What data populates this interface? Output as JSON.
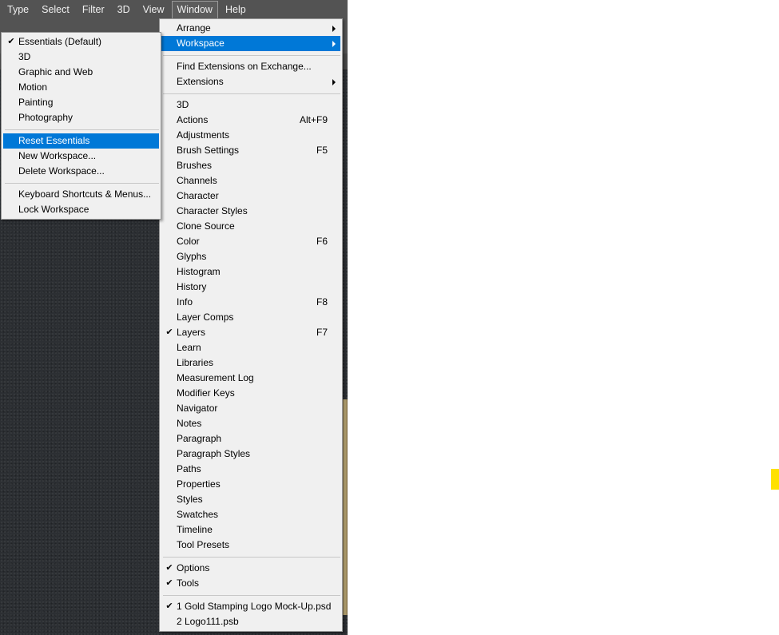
{
  "menubar": {
    "items": [
      {
        "label": "Type"
      },
      {
        "label": "Select"
      },
      {
        "label": "Filter"
      },
      {
        "label": "3D"
      },
      {
        "label": "View"
      },
      {
        "label": "Window",
        "active": true
      },
      {
        "label": "Help"
      }
    ]
  },
  "window_menu": {
    "items": [
      {
        "label": "Arrange",
        "submenu": true
      },
      {
        "label": "Workspace",
        "submenu": true,
        "highlighted": true
      },
      {
        "separator": true
      },
      {
        "label": "Find Extensions on Exchange..."
      },
      {
        "label": "Extensions",
        "submenu": true
      },
      {
        "separator": true
      },
      {
        "label": "3D"
      },
      {
        "label": "Actions",
        "shortcut": "Alt+F9"
      },
      {
        "label": "Adjustments"
      },
      {
        "label": "Brush Settings",
        "shortcut": "F5"
      },
      {
        "label": "Brushes"
      },
      {
        "label": "Channels"
      },
      {
        "label": "Character"
      },
      {
        "label": "Character Styles"
      },
      {
        "label": "Clone Source"
      },
      {
        "label": "Color",
        "shortcut": "F6"
      },
      {
        "label": "Glyphs"
      },
      {
        "label": "Histogram"
      },
      {
        "label": "History"
      },
      {
        "label": "Info",
        "shortcut": "F8"
      },
      {
        "label": "Layer Comps"
      },
      {
        "label": "Layers",
        "shortcut": "F7",
        "checked": true
      },
      {
        "label": "Learn"
      },
      {
        "label": "Libraries"
      },
      {
        "label": "Measurement Log"
      },
      {
        "label": "Modifier Keys"
      },
      {
        "label": "Navigator"
      },
      {
        "label": "Notes"
      },
      {
        "label": "Paragraph"
      },
      {
        "label": "Paragraph Styles"
      },
      {
        "label": "Paths"
      },
      {
        "label": "Properties"
      },
      {
        "label": "Styles"
      },
      {
        "label": "Swatches"
      },
      {
        "label": "Timeline"
      },
      {
        "label": "Tool Presets"
      },
      {
        "separator": true
      },
      {
        "label": "Options",
        "checked": true
      },
      {
        "label": "Tools",
        "checked": true
      },
      {
        "separator": true
      },
      {
        "label": "1 Gold Stamping Logo Mock-Up.psd",
        "checked": true
      },
      {
        "label": "2 Logo111.psb"
      }
    ]
  },
  "workspace_submenu": {
    "items": [
      {
        "label": "Essentials (Default)",
        "checked": true
      },
      {
        "label": "3D"
      },
      {
        "label": "Graphic and Web"
      },
      {
        "label": "Motion"
      },
      {
        "label": "Painting"
      },
      {
        "label": "Photography"
      },
      {
        "separator": true
      },
      {
        "label": "Reset Essentials",
        "highlighted": true
      },
      {
        "label": "New Workspace..."
      },
      {
        "label": "Delete Workspace..."
      },
      {
        "separator": true
      },
      {
        "label": "Keyboard Shortcuts & Menus..."
      },
      {
        "label": "Lock Workspace"
      }
    ]
  },
  "colors": {
    "highlight": "#0078d7",
    "menubar": "#535353",
    "menu_bg": "#f0f0f0",
    "marker": "#ffe100"
  },
  "icons": {
    "check": "check-icon",
    "submenu_arrow": "chevron-right-icon"
  }
}
